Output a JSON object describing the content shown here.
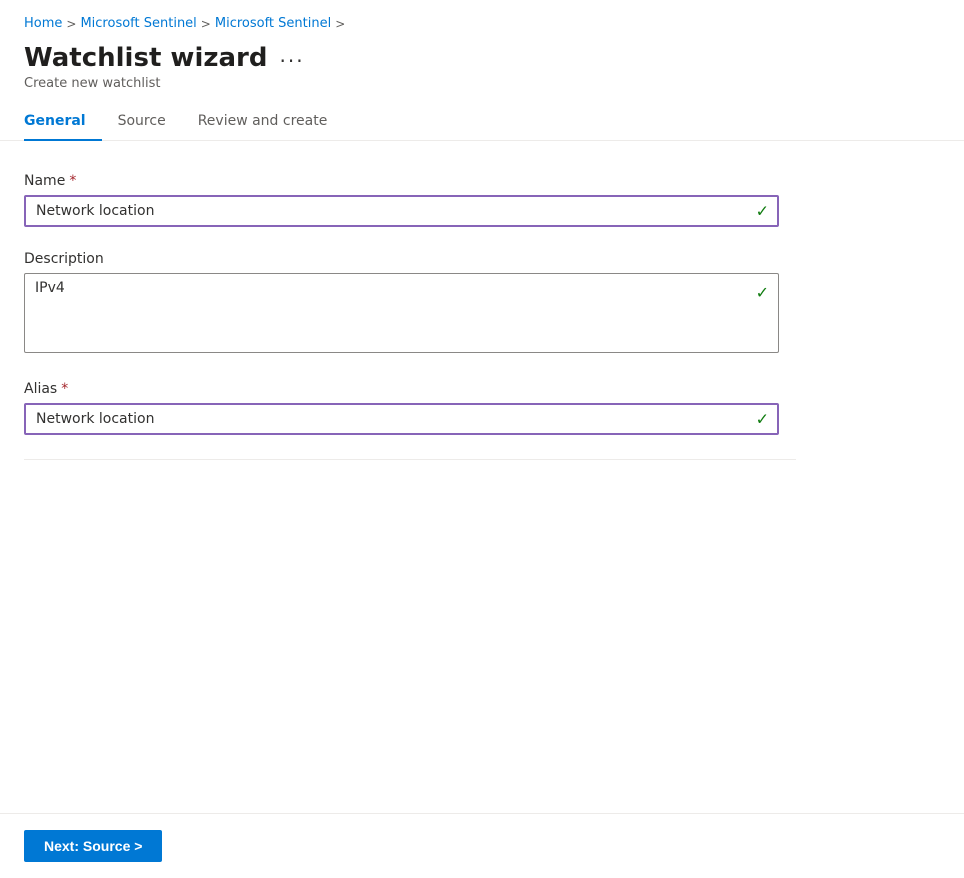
{
  "breadcrumb": {
    "items": [
      {
        "label": "Home",
        "href": "#"
      },
      {
        "label": "Microsoft Sentinel",
        "href": "#"
      },
      {
        "label": "Microsoft Sentinel",
        "href": "#"
      }
    ],
    "separators": [
      ">",
      ">",
      ">"
    ]
  },
  "header": {
    "title": "Watchlist wizard",
    "more_options_label": "···",
    "subtitle": "Create new watchlist"
  },
  "tabs": [
    {
      "id": "general",
      "label": "General",
      "active": true
    },
    {
      "id": "source",
      "label": "Source",
      "active": false
    },
    {
      "id": "review",
      "label": "Review and create",
      "active": false
    }
  ],
  "form": {
    "name_label": "Name",
    "name_required": "*",
    "name_value": "Network location",
    "description_label": "Description",
    "description_value": "IPv4",
    "alias_label": "Alias",
    "alias_required": "*",
    "alias_value": "Network location"
  },
  "footer": {
    "next_button_label": "Next: Source >"
  },
  "icons": {
    "checkmark": "✓"
  }
}
